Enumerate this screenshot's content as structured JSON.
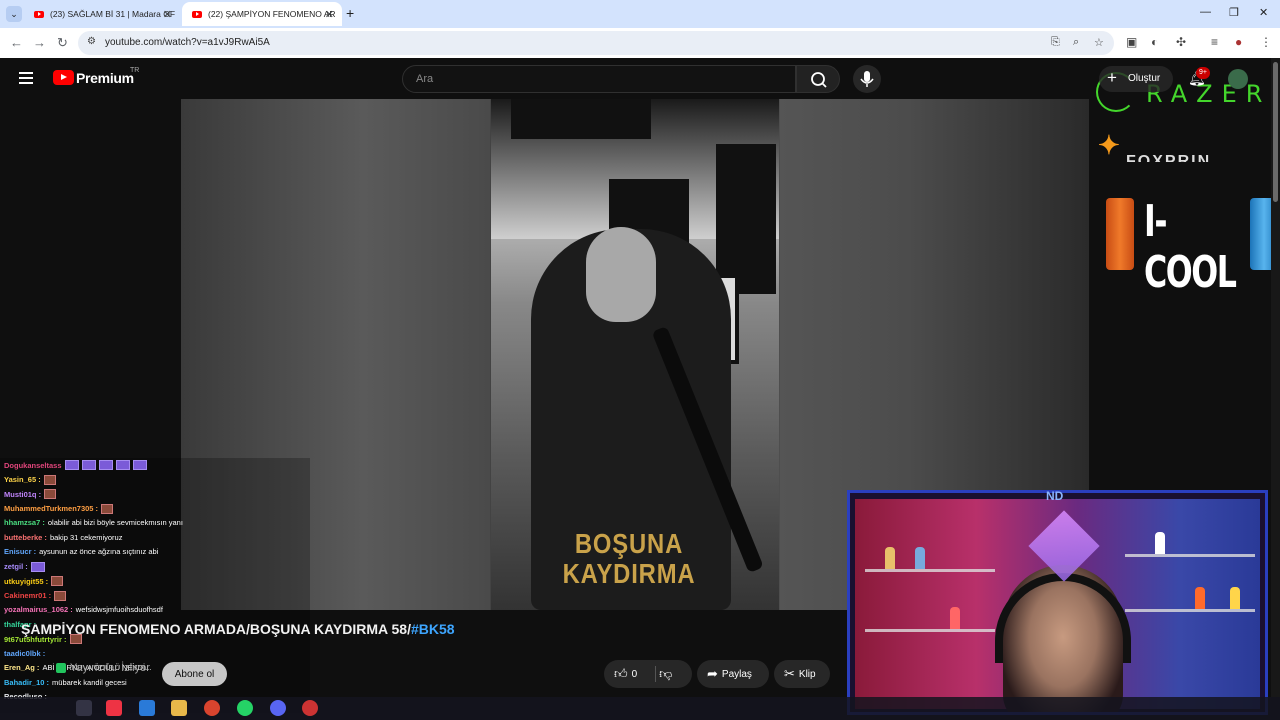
{
  "browser": {
    "tabs": [
      {
        "title": "(23) SAĞLAM Bİ 31 | Madara OF",
        "active": false
      },
      {
        "title": "(22) ŞAMPİYON FENOMENO AR",
        "active": true
      }
    ],
    "url": "youtube.com/watch?v=a1vJ9RwAi5A"
  },
  "youtube": {
    "brand": "Premium",
    "region": "TR",
    "search_placeholder": "Ara",
    "create_label": "Oluştur",
    "notif_count": "9+"
  },
  "video": {
    "caption_line1": "BOŞUNA",
    "caption_line2": "KAYDIRMA",
    "title_main": "ŞAMPİYON FENOMENO ARMADA/BOŞUNA KAYDIRMA 58/",
    "title_tag": "#BK58",
    "viewers_label": "Yayıncılar İzliyor",
    "subscribe_label": "Abone ol",
    "like_count": "0",
    "share_label": "Paylaş",
    "clip_label": "Klip"
  },
  "ads": {
    "razer": "RAZER",
    "fox": "FOXPRIN",
    "icool": "I-COOL",
    "cam_logo": "ND"
  },
  "chat": [
    {
      "user": "Dogukanseltass",
      "msg": "",
      "color": "#e0457b",
      "emotes": "ppppp"
    },
    {
      "user": "Yasin_65 :",
      "msg": "",
      "color": "#ffd54a",
      "emotes": "e"
    },
    {
      "user": "Musti01q :",
      "msg": "",
      "color": "#c084fc",
      "emotes": "e"
    },
    {
      "user": "MuhammedTurkmen7305 :",
      "msg": "",
      "color": "#ff9f43",
      "emotes": "e"
    },
    {
      "user": "hhamzsa7 :",
      "msg": "olabilir abi bizi böyle sevmicekmısın yanı",
      "color": "#4ade80",
      "emotes": ""
    },
    {
      "user": "butteberke :",
      "msg": "bakip 31 cekemiyoruz",
      "color": "#f87171",
      "emotes": ""
    },
    {
      "user": "Enisucr :",
      "msg": "aysunun az önce ağzına sıçtınız abi",
      "color": "#60a5fa",
      "emotes": ""
    },
    {
      "user": "zetgil :",
      "msg": "",
      "color": "#a78bfa",
      "emotes": "p"
    },
    {
      "user": "utkuyigit55 :",
      "msg": "",
      "color": "#facc15",
      "emotes": "e"
    },
    {
      "user": "Cakinemr01 :",
      "msg": "",
      "color": "#ef4444",
      "emotes": "e"
    },
    {
      "user": "yozalmairus_1062 :",
      "msg": "wefsidwsjmfuoihsduofhsdf",
      "color": "#f472b6",
      "emotes": ""
    },
    {
      "user": "thalfapr :",
      "msg": "",
      "color": "#34d399",
      "emotes": ""
    },
    {
      "user": "9t67ut5hfutrtyrir :",
      "msg": "",
      "color": "#a3e635",
      "emotes": "e"
    },
    {
      "user": "taadic0lbk :",
      "msg": "",
      "color": "#60a5fa",
      "emotes": ""
    },
    {
      "user": "Eren_Ag :",
      "msg": "ABİ TURNUVA ÖDÜLÜ NEYDİ...",
      "color": "#fde68a",
      "emotes": ""
    },
    {
      "user": "Bahadir_10 :",
      "msg": "mübarek kandil gecesi",
      "color": "#38bdf8",
      "emotes": ""
    },
    {
      "user": "Recodluso :",
      "msg": "",
      "color": "#e5e7eb",
      "emotes": ""
    }
  ],
  "colors": {
    "accent_red": "#ff0000",
    "link_blue": "#3ea6ff",
    "razer_green": "#44d62c",
    "cam_border": "#2a3fbf"
  }
}
